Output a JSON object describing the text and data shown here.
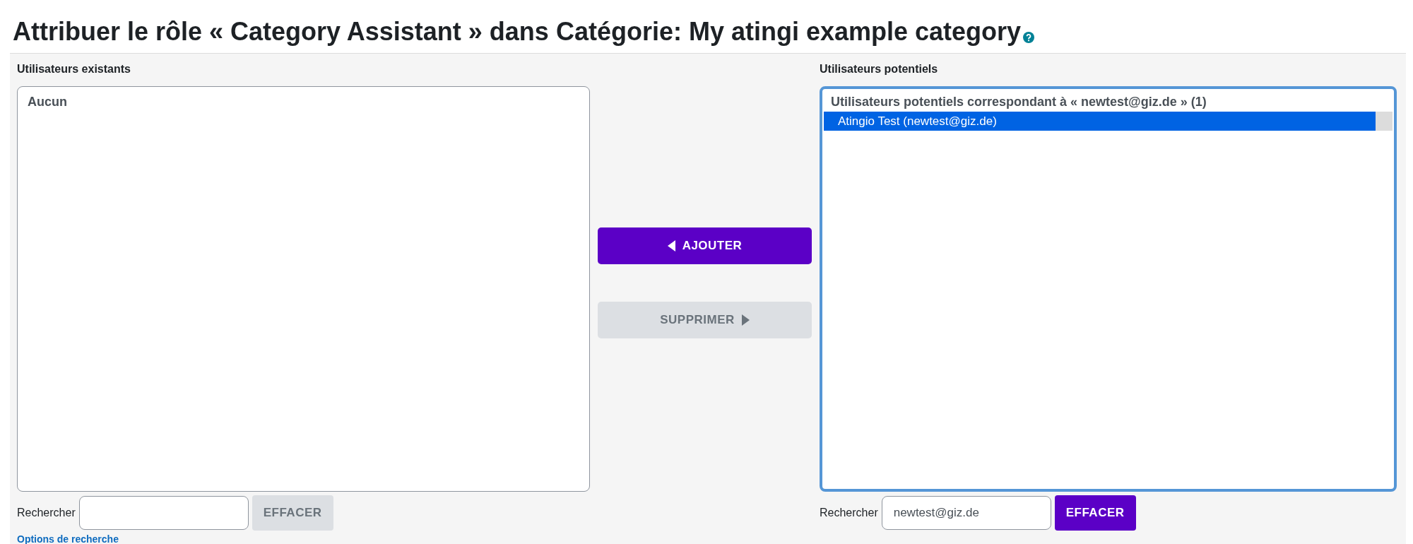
{
  "title": "Attribuer le rôle « Category Assistant » dans Catégorie: My atingi example category",
  "existing": {
    "label": "Utilisateurs existants",
    "focused": false,
    "groups": [
      {
        "header": "Aucun"
      }
    ],
    "search": {
      "label": "Rechercher",
      "clear_button": {
        "label": "EFFACER",
        "disabled": true
      }
    }
  },
  "actions": [
    {
      "label": "AJOUTER",
      "kind": "add",
      "disabled": false
    },
    {
      "label": "SUPPRIMER",
      "kind": "remove",
      "disabled": true
    }
  ],
  "potential": {
    "label": "Utilisateurs potentiels",
    "focused": true,
    "groups": [
      {
        "header": "Utilisateurs potentiels correspondant à « newtest@giz.de » (1)",
        "options": [
          {
            "label": "Atingio Test (newtest@giz.de)",
            "selected": true
          }
        ]
      }
    ],
    "search": {
      "label": "Rechercher",
      "value": "newtest@giz.de",
      "clear_button": {
        "label": "EFFACER",
        "disabled": false
      }
    }
  },
  "search_options_link": "Options de recherche"
}
